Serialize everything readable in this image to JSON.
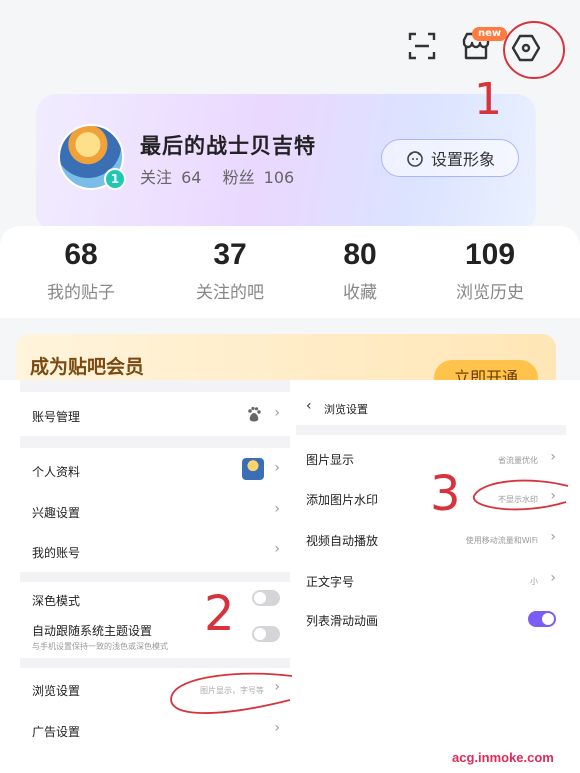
{
  "profile": {
    "new_badge": "new",
    "username": "最后的战士贝吉特",
    "follow_label": "关注",
    "follow_count": "64",
    "fans_label": "粉丝",
    "fans_count": "106",
    "level": "1",
    "avatar_button": "设置形象"
  },
  "stats": [
    {
      "num": "68",
      "label": "我的贴子"
    },
    {
      "num": "37",
      "label": "关注的吧"
    },
    {
      "num": "80",
      "label": "收藏"
    },
    {
      "num": "109",
      "label": "浏览历史"
    }
  ],
  "vip": {
    "title": "成为贴吧会员",
    "button": "立即开通"
  },
  "settings": {
    "account": "账号管理",
    "personal": "个人资料",
    "interest": "兴趣设置",
    "my_account": "我的账号",
    "dark_mode": "深色模式",
    "follow_system": "自动跟随系统主题设置",
    "follow_system_sub": "与手机设置保持一致的浅色或深色模式",
    "browse": "浏览设置",
    "browse_hint": "图片显示，字号等",
    "ads": "广告设置"
  },
  "browse_settings": {
    "title": "浏览设置",
    "image_display": "图片显示",
    "image_display_value": "省流量优化",
    "watermark": "添加图片水印",
    "watermark_value": "不显示水印",
    "autoplay": "视频自动播放",
    "autoplay_value": "使用移动流量和WiFi",
    "font_size": "正文字号",
    "font_size_value": "小",
    "list_animation": "列表滑动动画",
    "list_animation_on": true
  },
  "annotations": {
    "one": "1",
    "two": "2",
    "three": "3"
  },
  "watermark_text": "acg.inmoke.com",
  "colors": {
    "annotation": "#d7333c",
    "toggle_on": "#7b5cf5",
    "vip_button": "#ffc24a"
  }
}
